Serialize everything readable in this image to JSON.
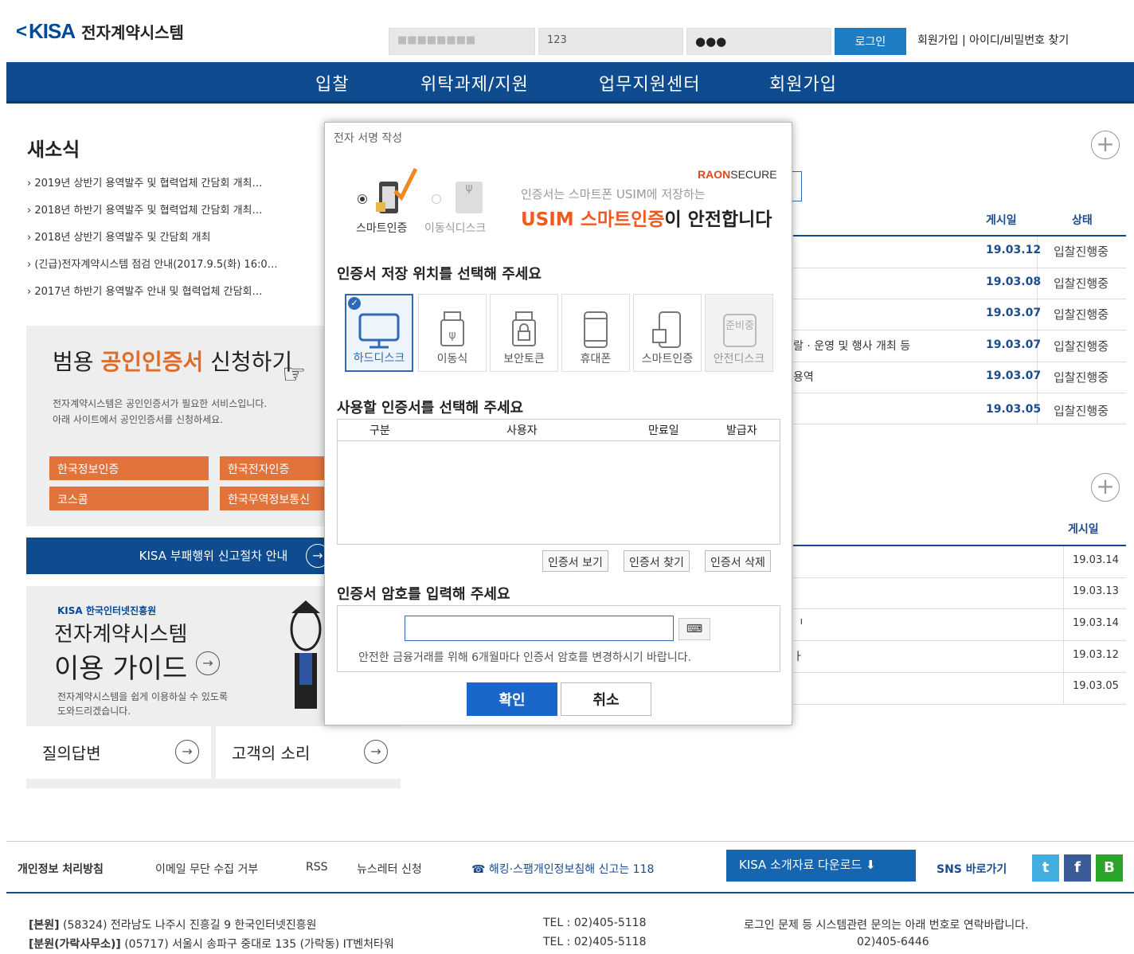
{
  "header": {
    "logo_mark": "<",
    "logo_text": "KISA",
    "logo_title": "전자계약시스템",
    "id_value": "■■■■■■■■",
    "field2_value": "123",
    "password_value": "●●●",
    "login_label": "로그인",
    "links": "회원가입 | 아이디/비밀번호 찾기"
  },
  "nav": {
    "items": [
      "입찰",
      "위탁과제/지원",
      "업무지원센터",
      "회원가입"
    ]
  },
  "news": {
    "title": "새소식",
    "items": [
      "› 2019년 상반기 용역발주 및 협력업체 간담회 개최…",
      "› 2018년 하반기 용역발주 및 협력업체 간담회 개최…",
      "› 2018년 상반기 용역발주 및 간담회 개최",
      "› (긴급)전자계약시스템 점검 안내(2017.9.5(화) 16:0…",
      "› 2017년 하반기 용역발주 안내 및 협력업체 간담회…"
    ]
  },
  "table1": {
    "headers": [
      "게시일",
      "상태"
    ],
    "rows": [
      {
        "title": "",
        "date": "19.03.12",
        "status": "입찰진행중"
      },
      {
        "title": "",
        "date": "19.03.08",
        "status": "입찰진행중"
      },
      {
        "title": "",
        "date": "19.03.07",
        "status": "입찰진행중"
      },
      {
        "title": "랄 · 운영 및 행사 개최 등",
        "date": "19.03.07",
        "status": "입찰진행중"
      },
      {
        "title": "용역",
        "date": "19.03.07",
        "status": "입찰진행중"
      },
      {
        "title": "",
        "date": "19.03.05",
        "status": "입찰진행중"
      }
    ]
  },
  "table2": {
    "header": "게시일",
    "rows": [
      {
        "title": "",
        "date": "19.03.14"
      },
      {
        "title": "",
        "date": "19.03.13"
      },
      {
        "title": "ᅵ",
        "date": "19.03.14"
      },
      {
        "title": "ㅏ",
        "date": "19.03.12"
      },
      {
        "title": "",
        "date": "19.03.05"
      }
    ]
  },
  "cert_promo": {
    "title_a": "범용",
    "title_b": "공인인증서",
    "title_c": "신청하기",
    "desc1": "전자계약시스템은 공인인증서가 필요한 서비스입니다.",
    "desc2": "아래 사이트에서 공인인증서를 신청하세요.",
    "providers": [
      "한국정보인증",
      "한국전자인증",
      "코스콤",
      "한국무역정보통신"
    ]
  },
  "kisa_bar": "KISA 부패행위 신고절차 안내",
  "guide": {
    "org": "KISA 한국인터넷진흥원",
    "title1": "전자계약시스템",
    "title2": "이용 가이드",
    "desc1": "전자계약시스템을 쉽게 이용하실 수 있도록",
    "desc2": "도와드리겠습니다."
  },
  "qa": {
    "left": "질의답변",
    "right": "고객의 소리"
  },
  "footer": {
    "links": [
      "개인정보 처리방침",
      "이메일 무단 수집 거부",
      "RSS",
      "뉴스레터 신청"
    ],
    "report": "☎ 해킹·스팸개인정보침해 신고는 118",
    "download": "KISA 소개자료 다운로드 ⬇",
    "sns_label": "SNS 바로가기",
    "sns": [
      "t",
      "f",
      "B"
    ],
    "addr1_label": "[본원]",
    "addr1": "(58324) 전라남도 나주시 진흥길 9 한국인터넷진흥원",
    "addr1_tel": "TEL : 02)405-5118",
    "addr2_label": "[분원(가락사무소)]",
    "addr2": "(05717) 서울시 송파구 중대로 135 (가락동) IT벤처타워",
    "addr2_tel": "TEL : 02)405-5118",
    "notice": "로그인 문제 등 시스템관련 문의는 아래 번호로 연락바랍니다.",
    "notice_tel": "02)405-6446"
  },
  "dialog": {
    "title": "전자 서명 작성",
    "radio_smart": "스마트인증",
    "radio_usb": "이동식디스크",
    "brand_raon": "RAON",
    "brand_secure": "SECURE",
    "ad_line1": "인증서는 스마트폰 USIM에 저장하는",
    "ad_line2a": "USIM 스마트인증",
    "ad_line2b": "이 안전합니다",
    "storage_title": "인증서 저장 위치를 선택해 주세요",
    "storage": [
      "하드디스크",
      "이동식",
      "보안토큰",
      "휴대폰",
      "스마트인증",
      "안전디스크"
    ],
    "preparing": "준비중",
    "cert_title": "사용할 인증서를 선택해 주세요",
    "cert_cols": [
      "구분",
      "사용자",
      "만료일",
      "발급자"
    ],
    "btn_view": "인증서 보기",
    "btn_find": "인증서 찾기",
    "btn_delete": "인증서 삭제",
    "pw_title": "인증서 암호를 입력해 주세요",
    "pw_notice": "안전한 금융거래를 위해 6개월마다 인증서 암호를 변경하시기 바랍니다.",
    "ok": "확인",
    "cancel": "취소"
  },
  "colors": {
    "navy": "#0f4b8f",
    "accent": "#1b66c9",
    "orange": "#e2733a"
  }
}
